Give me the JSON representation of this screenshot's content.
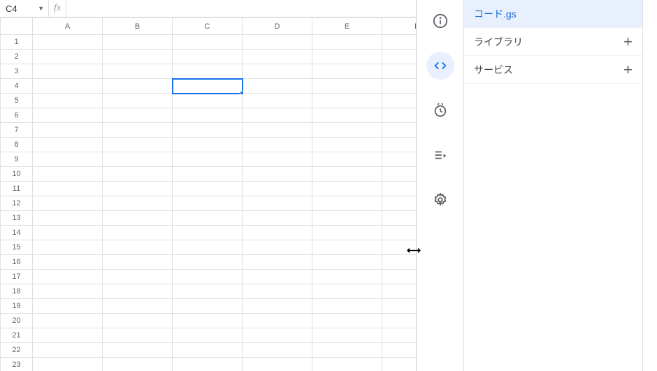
{
  "spreadsheet": {
    "name_box": "C4",
    "fx_label": "fx",
    "formula": "",
    "columns": [
      "A",
      "B",
      "C",
      "D",
      "E",
      "F"
    ],
    "rows": [
      "1",
      "2",
      "3",
      "4",
      "5",
      "6",
      "7",
      "8",
      "9",
      "10",
      "11",
      "12",
      "13",
      "14",
      "15",
      "16",
      "17",
      "18",
      "19",
      "20",
      "21",
      "22",
      "23"
    ],
    "selected": {
      "row": "4",
      "col": "C"
    }
  },
  "rail": {
    "info": "overview",
    "code": "editor",
    "triggers": "triggers",
    "executions": "executions",
    "settings": "settings"
  },
  "files": {
    "code_file": "コード.gs",
    "libraries": "ライブラリ",
    "services": "サービス"
  }
}
